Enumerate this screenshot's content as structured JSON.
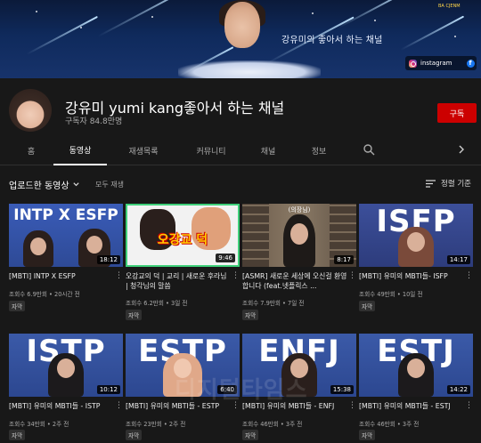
{
  "banner": {
    "title": "강유미의 좋아서 하는 채널",
    "logos": "BA CJENM",
    "instagram_label": "instagram",
    "facebook_glyph": "f"
  },
  "channel": {
    "name": "강유미 yumi kang좋아서 하는 채널",
    "subscribers": "구독자 84.8만명",
    "subscribe_label": "구독"
  },
  "tabs": {
    "home": "홈",
    "videos": "동영상",
    "playlists": "재생목록",
    "community": "커뮤니티",
    "channels": "채널",
    "about": "정보"
  },
  "section": {
    "title": "업로드한 동영상",
    "play_all": "모두 재생",
    "sort": "정렬 기준"
  },
  "videos": [
    {
      "thumb_text": "INTP X ESFP",
      "duration": "18:12",
      "title": "[MBTI] INTP X ESFP",
      "meta": "조회수 6.9만회 • 20시간 전",
      "badge": "자막"
    },
    {
      "thumb_text": "오강교 덕",
      "duration": "9:46",
      "title": "오강교의 덕 | 교리 | 새로운 후라님 | 청각님의 말씀",
      "meta": "조회수 6.2만회 • 3일 전",
      "badge": "자막"
    },
    {
      "thumb_text": "(의장님)",
      "duration": "8:17",
      "title": "[ASMR] 새로운 세상에 오신걸 환영합니다 (feat.넷플릭스 ...",
      "meta": "조회수 7.9만회 • 7일 전",
      "badge": "자막"
    },
    {
      "thumb_text": "ISFP",
      "duration": "14:17",
      "title": "[MBTI] 유미의 MBTI들- ISFP",
      "meta": "조회수 49만회 • 10일 전",
      "badge": "자막"
    },
    {
      "thumb_text": "ISTP",
      "duration": "10:12",
      "title": "[MBTI] 유미의 MBTI들 - ISTP",
      "meta": "조회수 34만회 • 2주 전",
      "badge": "자막"
    },
    {
      "thumb_text": "ESTP",
      "duration": "6:40",
      "title": "[MBTI] 유미의 MBTI들 - ESTP",
      "meta": "조회수 23만회 • 2주 전",
      "badge": "자막"
    },
    {
      "thumb_text": "ENFJ",
      "duration": "15:38",
      "title": "[MBTI] 유미의 MBTI들 - ENFJ",
      "meta": "조회수 46만회 • 3주 전",
      "badge": "자막"
    },
    {
      "thumb_text": "ESTJ",
      "duration": "14:22",
      "title": "[MBTI] 유미의 MBTI들 - ESTJ",
      "meta": "조회수 46만회 • 3주 전",
      "badge": "자막"
    }
  ],
  "watermark": "디지털타임스",
  "colors": {
    "background": "#181818",
    "subscribe": "#cc0000",
    "thumb_blue": "#3b5aa8",
    "thumb_green": "#3fd07a"
  }
}
